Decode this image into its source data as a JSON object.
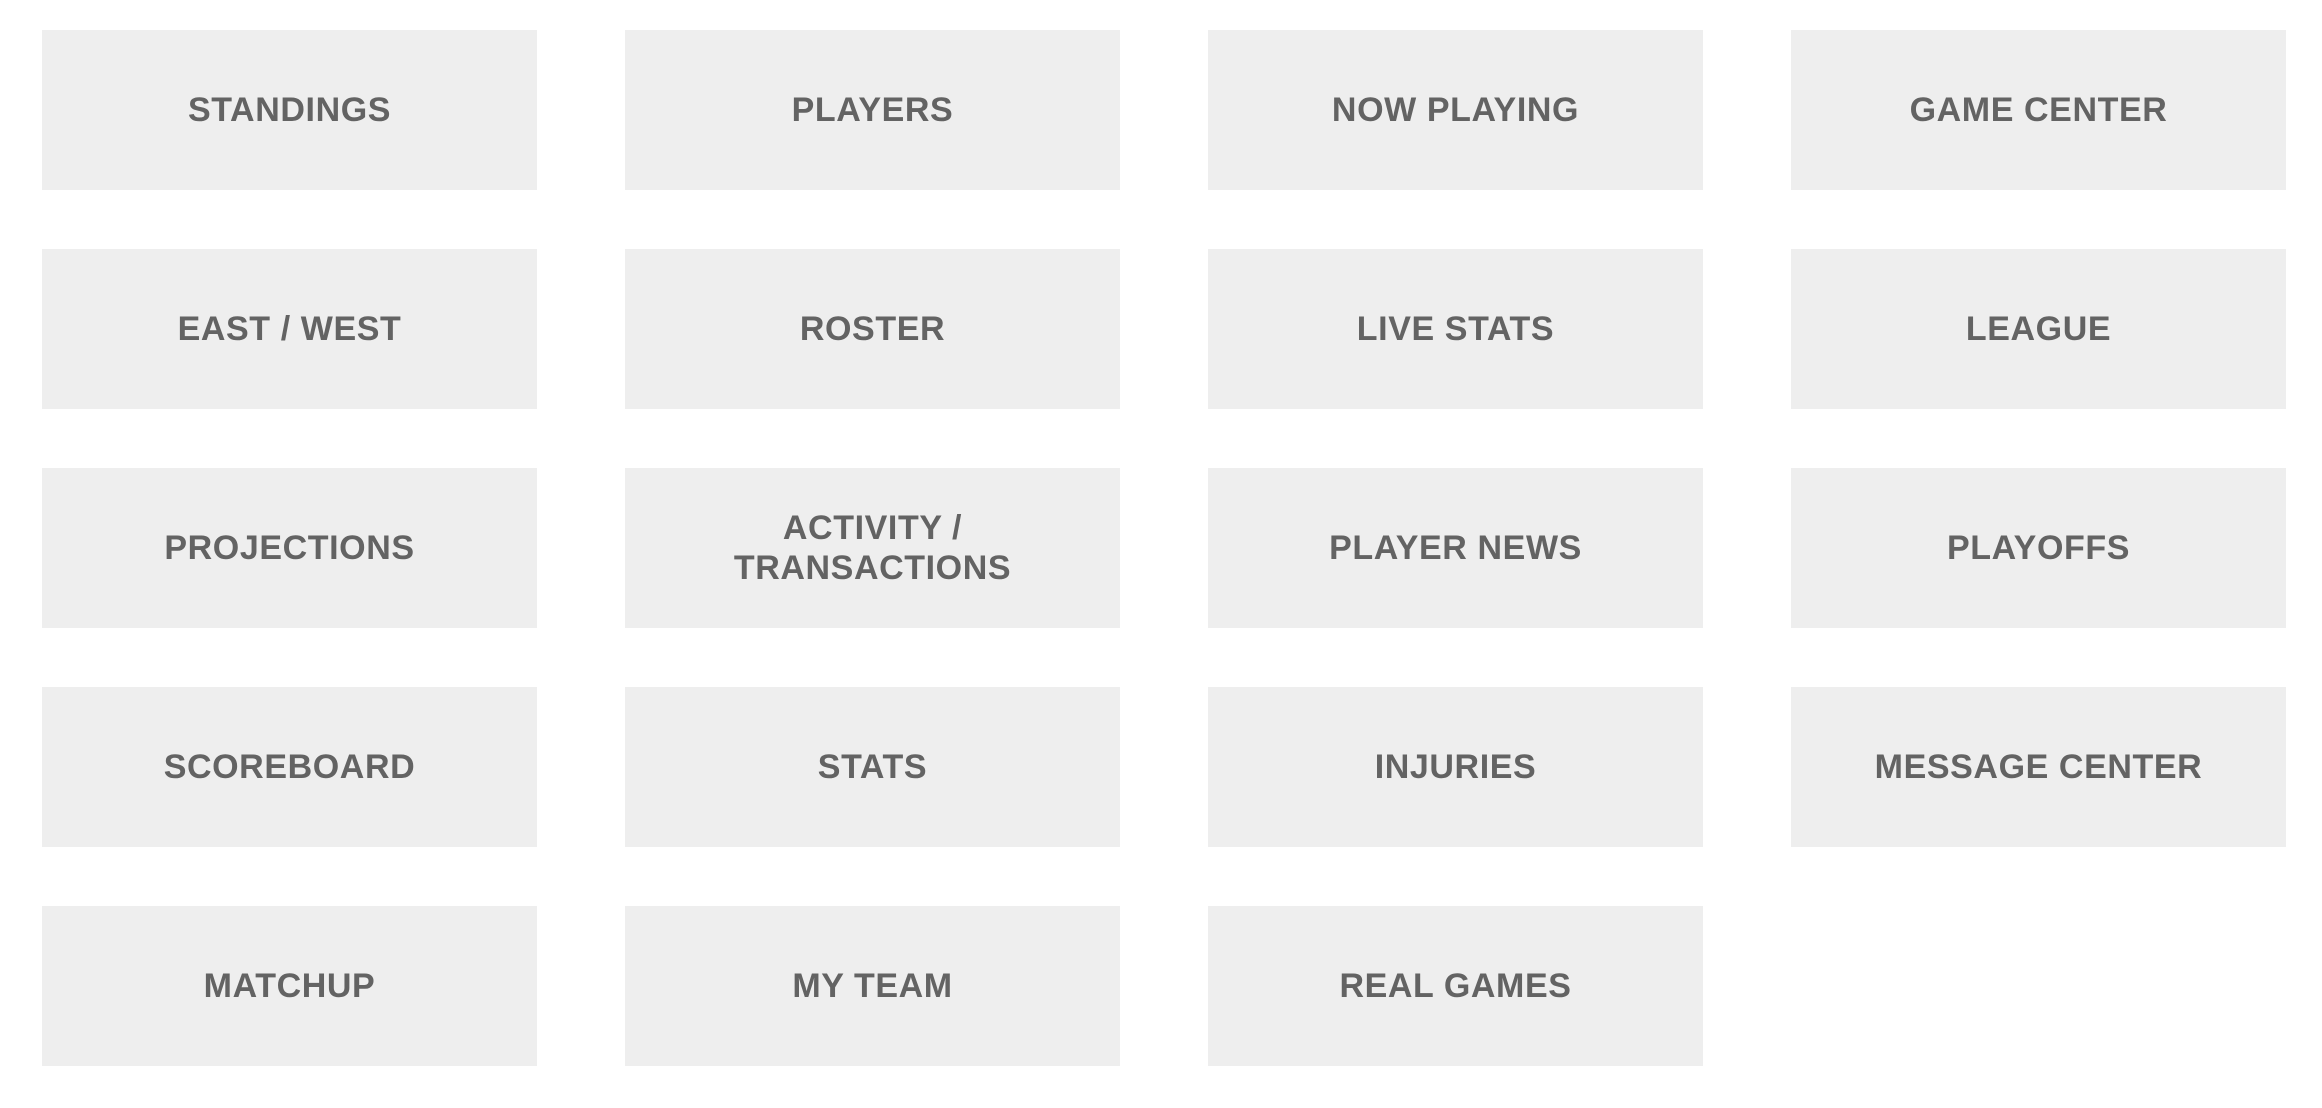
{
  "page": {
    "title": "Fantasy League Navigation",
    "background_color": "#ffffff"
  },
  "theme": {
    "tile_background": "#eeeeee",
    "tile_label_color": "#636363"
  },
  "grid": {
    "columns": 4,
    "rows": 5,
    "tiles": [
      {
        "label": "STANDINGS",
        "name": "tile-standings"
      },
      {
        "label": "PLAYERS",
        "name": "tile-players"
      },
      {
        "label": "NOW PLAYING",
        "name": "tile-now-playing"
      },
      {
        "label": "GAME CENTER",
        "name": "tile-game-center"
      },
      {
        "label": "EAST / WEST",
        "name": "tile-east-west"
      },
      {
        "label": "ROSTER",
        "name": "tile-roster"
      },
      {
        "label": "LIVE STATS",
        "name": "tile-live-stats"
      },
      {
        "label": "LEAGUE",
        "name": "tile-league"
      },
      {
        "label": "PROJECTIONS",
        "name": "tile-projections"
      },
      {
        "label": "ACTIVITY /\nTRANSACTIONS",
        "name": "tile-activity-transactions"
      },
      {
        "label": "PLAYER NEWS",
        "name": "tile-player-news"
      },
      {
        "label": "PLAYOFFS",
        "name": "tile-playoffs"
      },
      {
        "label": "SCOREBOARD",
        "name": "tile-scoreboard"
      },
      {
        "label": "STATS",
        "name": "tile-stats"
      },
      {
        "label": "INJURIES",
        "name": "tile-injuries"
      },
      {
        "label": "MESSAGE CENTER",
        "name": "tile-message-center"
      },
      {
        "label": "MATCHUP",
        "name": "tile-matchup"
      },
      {
        "label": "MY TEAM",
        "name": "tile-my-team"
      },
      {
        "label": "REAL GAMES",
        "name": "tile-real-games"
      },
      {
        "label": "",
        "name": "tile-empty-slot",
        "empty": true
      }
    ]
  }
}
